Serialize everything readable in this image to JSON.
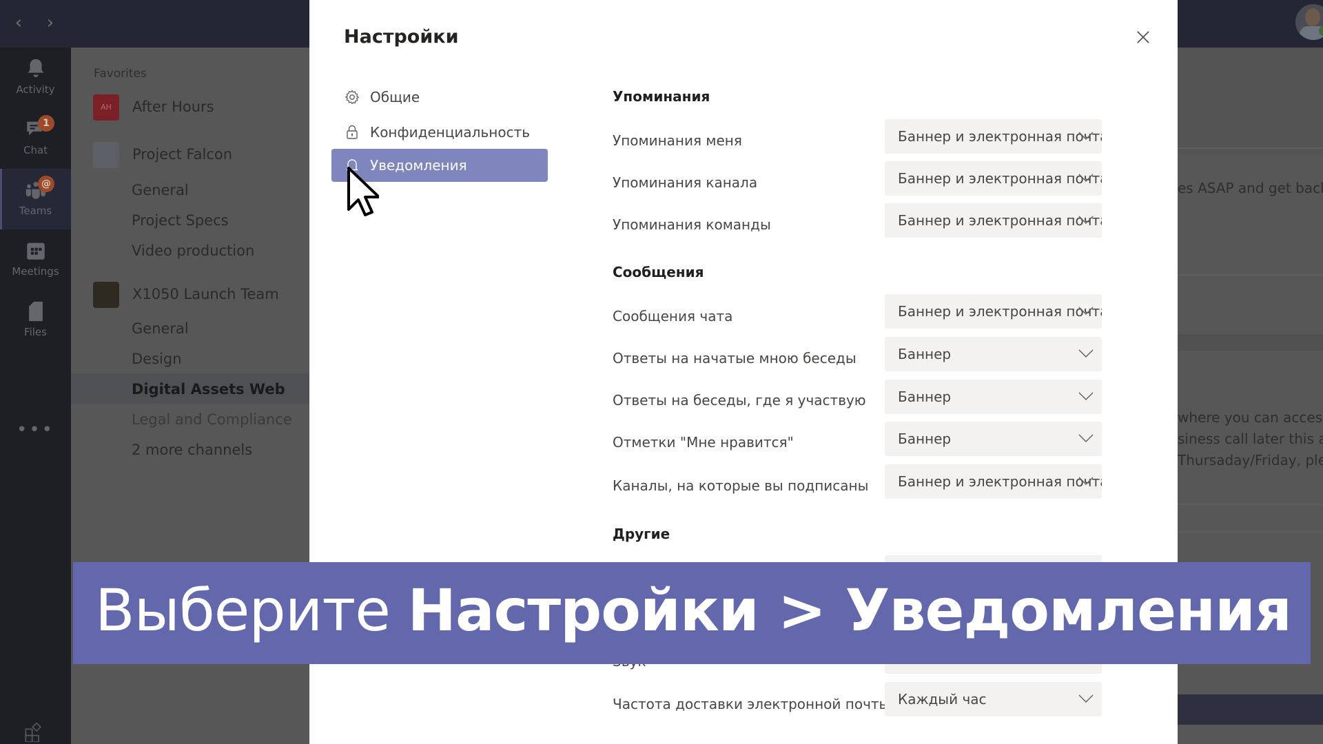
{
  "app": {
    "nav": {
      "back_icon": "‹",
      "forward_icon": "›"
    },
    "rail": [
      {
        "id": "activity",
        "label": "Activity",
        "icon": "bell-icon",
        "badge": null
      },
      {
        "id": "chat",
        "label": "Chat",
        "icon": "chat-icon",
        "badge": "1"
      },
      {
        "id": "teams",
        "label": "Teams",
        "icon": "teams-icon",
        "badge": "@"
      },
      {
        "id": "meetings",
        "label": "Meetings",
        "icon": "calendar-icon",
        "badge": null
      },
      {
        "id": "files",
        "label": "Files",
        "icon": "file-icon",
        "badge": null
      }
    ],
    "rail_more": "•••",
    "channels": {
      "favorites_label": "Favorites",
      "teams": [
        {
          "name": "After Hours",
          "avatar_text": "AH",
          "avatar_color": "#7a2026",
          "channels": []
        },
        {
          "name": "Project Falcon",
          "avatar_text": "",
          "avatar_color": "#5d5f66",
          "channels": [
            "General",
            "Project Specs",
            "Video production"
          ]
        },
        {
          "name": "X1050 Launch Team",
          "avatar_text": "",
          "avatar_color": "#2e2a22",
          "channels": [
            "General",
            "Design",
            "Digital Assets Web",
            "Legal and Compliance",
            "2 more channels"
          ]
        }
      ],
      "selected_channel": "Digital Assets Web"
    },
    "background_messages": [
      "es ASAP and get back",
      "where you can access",
      "siness call later this aft",
      "Thursaday/Friday, ple"
    ]
  },
  "settings": {
    "title": "Настройки",
    "close_label": "×",
    "nav": [
      {
        "id": "general",
        "label": "Общие",
        "icon": "gear-icon",
        "active": false
      },
      {
        "id": "privacy",
        "label": "Конфиденциальность",
        "icon": "lock-icon",
        "active": false
      },
      {
        "id": "notifications",
        "label": "Уведомления",
        "icon": "bell-icon",
        "active": true
      }
    ],
    "sections": [
      {
        "title": "Упоминания",
        "rows": [
          {
            "label": "Упоминания меня",
            "value": "Баннер и электронная почта"
          },
          {
            "label": "Упоминания канала",
            "value": "Баннер и электронная почта"
          },
          {
            "label": "Упоминания команды",
            "value": "Баннер и электронная почта"
          }
        ]
      },
      {
        "title": "Сообщения",
        "rows": [
          {
            "label": "Сообщения чата",
            "value": "Баннер и электронная почта"
          },
          {
            "label": "Ответы на начатые мною беседы",
            "value": "Баннер"
          },
          {
            "label": "Ответы на беседы, где я участвую",
            "value": "Баннер"
          },
          {
            "label": "Отметки \"Мне нравится\"",
            "value": "Баннер"
          },
          {
            "label": "Каналы, на которые вы подписаны",
            "value": "Баннер и электронная почта"
          }
        ]
      },
      {
        "title": "Другие",
        "rows": [
          {
            "label": "",
            "value": ""
          },
          {
            "label": "Звук",
            "value": ""
          },
          {
            "label": "Частота доставки электронной почты",
            "value": "Каждый час"
          }
        ]
      }
    ]
  },
  "caption": {
    "prefix": "Выберите ",
    "bold": "Настройки > Уведомления",
    "background_color": "#6368ac"
  },
  "colors": {
    "accent": "#7f85bd",
    "dropdown_bg": "#f3f2f1",
    "badge": "#9c4a2a"
  }
}
